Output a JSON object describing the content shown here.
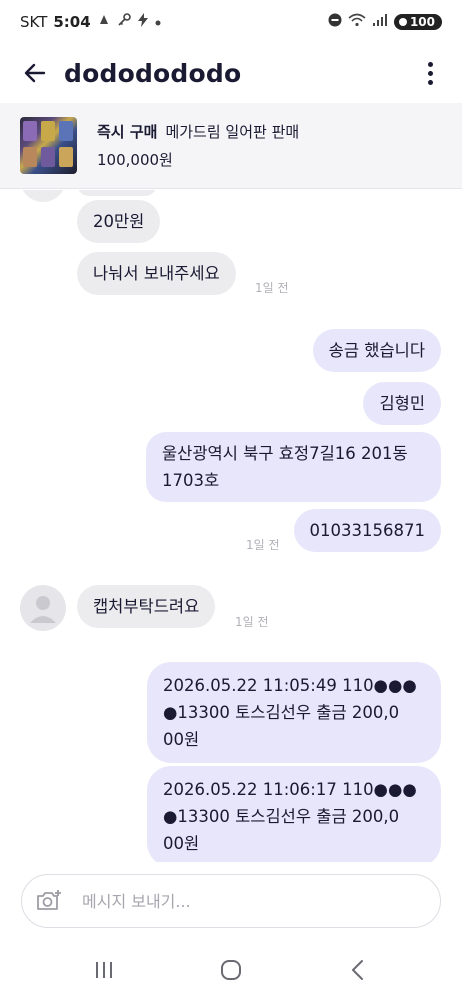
{
  "status_bar": {
    "carrier": "SKT",
    "time": "5:04",
    "battery": "100"
  },
  "header": {
    "title": "dodododo​do"
  },
  "product": {
    "tag": "즉시 구매",
    "name": "메가드림 일어판 판매",
    "price": "100,000원"
  },
  "messages": {
    "m1": "20만원",
    "m2": "나눠서 보내주세요",
    "m2_time": "1일 전",
    "m3": "송금 했습니다",
    "m4": "김형민",
    "m5_line1": "울산광역시 북구 효정7길16 201동",
    "m5_line2": "1703호",
    "m6": "01033156871",
    "m6_time": "1일 전",
    "m7": "캡처부탁드려요",
    "m7_time": "1일 전",
    "m8_line1": "2026.05.22 11:05:49 110●●●",
    "m8_line2": "●13300 토스김선우 출금 200,0",
    "m8_line3": "00원",
    "m9_line1": "2026.05.22 11:06:17 110●●●",
    "m9_line2": "●13300 토스김선우 출금 200,0",
    "m9_line3": "00원"
  },
  "input": {
    "placeholder": "메시지 보내기..."
  },
  "colors": {
    "incoming_bubble": "#ececef",
    "outgoing_bubble": "#e8e6fb",
    "text": "#1b1a33",
    "timestamp": "#b1b1b8"
  },
  "icons": {
    "back": "arrow-left-icon",
    "more": "more-vertical-icon",
    "camera": "camera-add-icon",
    "nav_recents": "recents-icon",
    "nav_home": "home-icon",
    "nav_back": "chevron-left-icon"
  }
}
